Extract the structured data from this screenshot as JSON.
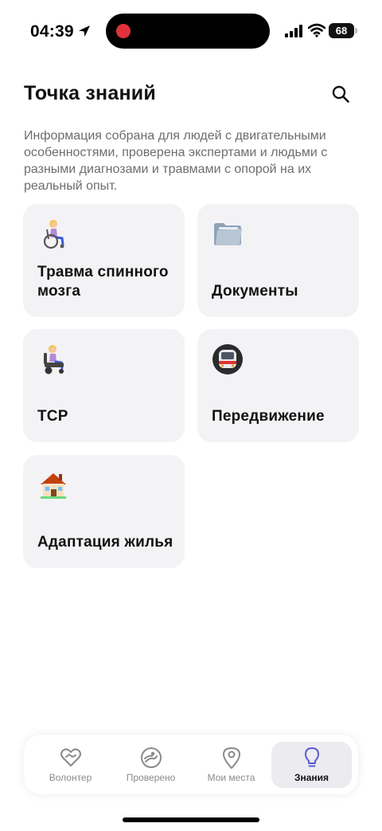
{
  "status_bar": {
    "time": "04:39",
    "battery": "68",
    "icons": [
      "location-arrow-icon",
      "record-dot-icon",
      "signal-icon",
      "wifi-icon",
      "battery-icon"
    ]
  },
  "header": {
    "title": "Точка знаний",
    "search_icon": "search-icon"
  },
  "description": "Информация собрана для людей с двигательными особенностями, проверена экспертами и людьми с разными диагнозами и травмами с опорой на их реальный опыт.",
  "cards": [
    {
      "label": "Травма спинного мозга",
      "icon": "wheelchair-person-icon"
    },
    {
      "label": "Документы",
      "icon": "folder-icon"
    },
    {
      "label": "ТСР",
      "icon": "power-wheelchair-person-icon"
    },
    {
      "label": "Передвижение",
      "icon": "metro-train-icon"
    },
    {
      "label": "Адаптация жилья",
      "icon": "house-icon"
    }
  ],
  "tab_bar": {
    "active": "Знания",
    "tabs": [
      {
        "label": "Волонтер",
        "icon": "heart-handshake-icon"
      },
      {
        "label": "Проверено",
        "icon": "verified-badge-icon"
      },
      {
        "label": "Мои места",
        "icon": "map-pin-icon"
      },
      {
        "label": "Знания",
        "icon": "lightbulb-icon"
      }
    ]
  },
  "colors": {
    "card_bg": "#f3f2f5",
    "active_tab_bg": "#ecebf0",
    "accent": "#5b5bd6",
    "description_text": "#6d6d72"
  }
}
